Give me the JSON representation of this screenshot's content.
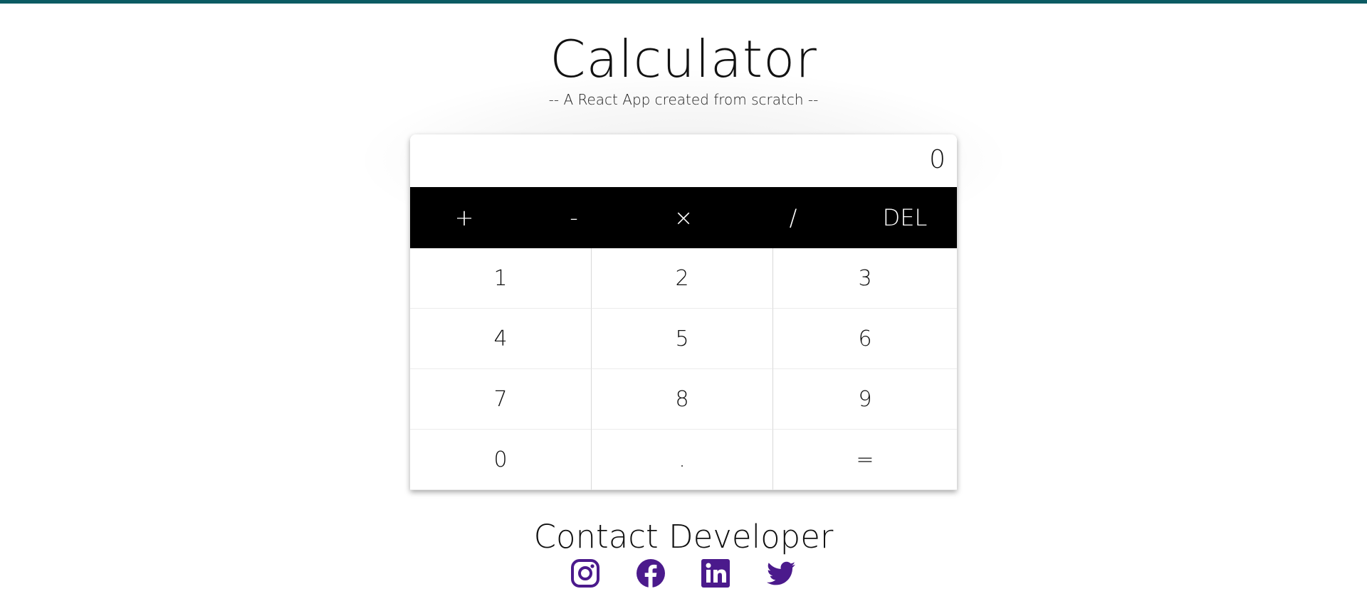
{
  "header": {
    "title": "Calculator",
    "subtitle": "-- A React App created from scratch --"
  },
  "calculator": {
    "display_value": "0",
    "operators": [
      "+",
      "-",
      "×",
      "/",
      "DEL"
    ],
    "keys": [
      "1",
      "2",
      "3",
      "4",
      "5",
      "6",
      "7",
      "8",
      "9",
      "0",
      ".",
      "="
    ]
  },
  "contact": {
    "title": "Contact Developer",
    "icons": [
      "instagram-icon",
      "facebook-icon",
      "linkedin-icon",
      "twitter-icon"
    ],
    "icon_color": "#4b1a8c"
  },
  "colors": {
    "top_bar": "#0b5b63",
    "operator_bar": "#000000"
  }
}
